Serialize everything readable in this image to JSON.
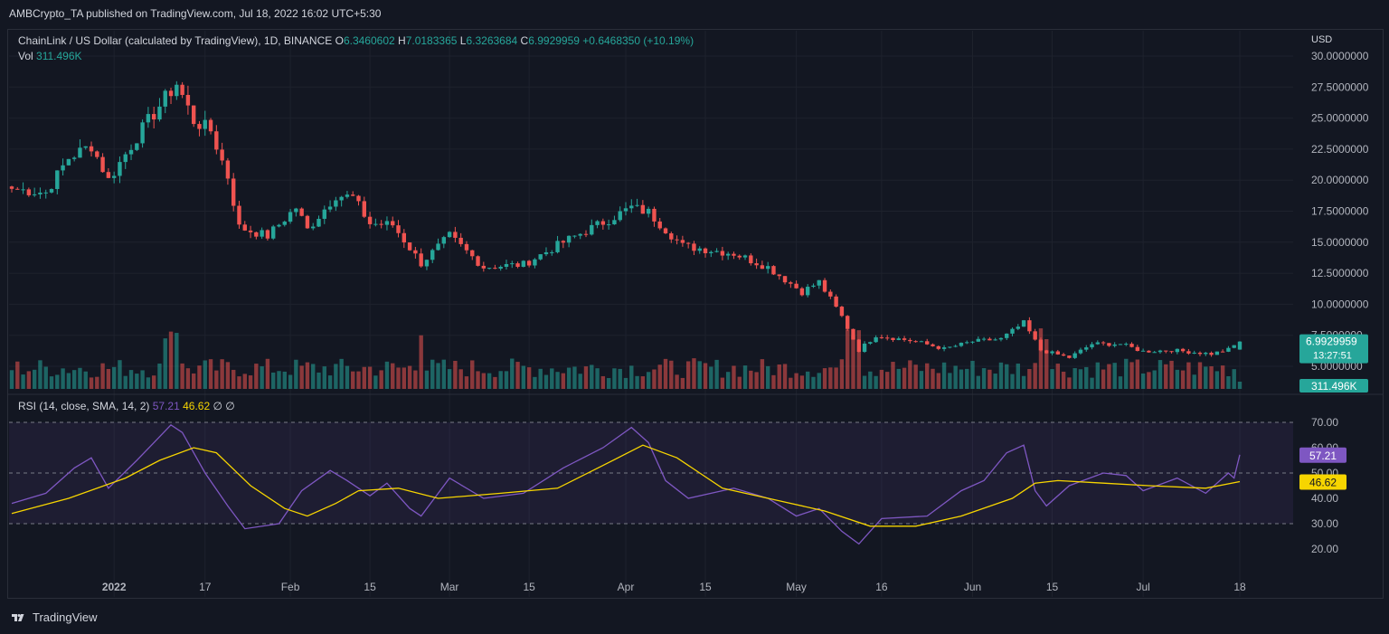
{
  "header": {
    "publisher": "AMBCrypto_TA published on TradingView.com, Jul 18, 2022 16:02 UTC+5:30"
  },
  "legend": {
    "symbol": "ChainLink / US Dollar (calculated by TradingView), 1D, BINANCE",
    "o_label": "O",
    "o_value": "6.3460602",
    "h_label": "H",
    "h_value": "7.0183365",
    "l_label": "L",
    "l_value": "6.3263684",
    "c_label": "C",
    "c_value": "6.9929959",
    "change": "+0.6468350 (+10.19%)",
    "vol_label": "Vol",
    "vol_value": "311.496K"
  },
  "rsi_legend": {
    "label": "RSI (14, close, SMA, 14, 2)",
    "rsi_value": "57.21",
    "sma_value": "46.62",
    "extra": "∅ ∅"
  },
  "price_axis": {
    "currency": "USD",
    "ticks": [
      "30.0000000",
      "27.5000000",
      "25.0000000",
      "22.5000000",
      "20.0000000",
      "17.5000000",
      "15.0000000",
      "12.5000000",
      "10.0000000",
      "7.5000000",
      "5.0000000"
    ],
    "last_price": "6.9929959",
    "countdown": "13:27:51",
    "volume_badge": "311.496K"
  },
  "rsi_axis": {
    "ticks": [
      "70.00",
      "60.00",
      "50.00",
      "40.00",
      "30.00",
      "20.00"
    ],
    "rsi_badge": "57.21",
    "sma_badge": "46.62"
  },
  "time_axis": {
    "labels": [
      "2022",
      "17",
      "Feb",
      "15",
      "Mar",
      "15",
      "Apr",
      "15",
      "May",
      "16",
      "Jun",
      "15",
      "Jul",
      "18"
    ]
  },
  "footer": {
    "brand": "TradingView"
  },
  "colors": {
    "up": "#26a69a",
    "down": "#ef5350",
    "rsi_line": "#7e57c2",
    "sma_line": "#f7d500",
    "background": "#131722",
    "grid": "#1e222d"
  },
  "chart_data": [
    {
      "type": "candlestick",
      "title": "ChainLink / US Dollar (calculated by TradingView), 1D, BINANCE",
      "ylabel": "USD",
      "ylim": [
        5,
        30
      ],
      "x_start": "2021-12-14",
      "x_end": "2022-07-18",
      "close_anchors": [
        {
          "date": "2021-12-14",
          "close": 19.3
        },
        {
          "date": "2021-12-20",
          "close": 19.0
        },
        {
          "date": "2021-12-24",
          "close": 21.8
        },
        {
          "date": "2021-12-28",
          "close": 22.8
        },
        {
          "date": "2021-12-31",
          "close": 20.0
        },
        {
          "date": "2022-01-05",
          "close": 23.5
        },
        {
          "date": "2022-01-09",
          "close": 26.0
        },
        {
          "date": "2022-01-12",
          "close": 27.8
        },
        {
          "date": "2022-01-15",
          "close": 24.8
        },
        {
          "date": "2022-01-18",
          "close": 24.0
        },
        {
          "date": "2022-01-21",
          "close": 20.3
        },
        {
          "date": "2022-01-23",
          "close": 16.2
        },
        {
          "date": "2022-01-28",
          "close": 15.5
        },
        {
          "date": "2022-02-02",
          "close": 17.8
        },
        {
          "date": "2022-02-04",
          "close": 16.0
        },
        {
          "date": "2022-02-09",
          "close": 18.8
        },
        {
          "date": "2022-02-12",
          "close": 18.6
        },
        {
          "date": "2022-02-15",
          "close": 16.5
        },
        {
          "date": "2022-02-19",
          "close": 16.4
        },
        {
          "date": "2022-02-24",
          "close": 13.3
        },
        {
          "date": "2022-03-01",
          "close": 15.5
        },
        {
          "date": "2022-03-07",
          "close": 13.0
        },
        {
          "date": "2022-03-14",
          "close": 13.2
        },
        {
          "date": "2022-03-21",
          "close": 15.0
        },
        {
          "date": "2022-03-28",
          "close": 16.6
        },
        {
          "date": "2022-04-02",
          "close": 17.8
        },
        {
          "date": "2022-04-05",
          "close": 17.4
        },
        {
          "date": "2022-04-11",
          "close": 14.7
        },
        {
          "date": "2022-04-20",
          "close": 14.1
        },
        {
          "date": "2022-04-26",
          "close": 13.0
        },
        {
          "date": "2022-05-02",
          "close": 11.0
        },
        {
          "date": "2022-05-05",
          "close": 11.8
        },
        {
          "date": "2022-05-09",
          "close": 9.0
        },
        {
          "date": "2022-05-12",
          "close": 6.3
        },
        {
          "date": "2022-05-15",
          "close": 7.5
        },
        {
          "date": "2022-05-22",
          "close": 7.0
        },
        {
          "date": "2022-05-27",
          "close": 6.4
        },
        {
          "date": "2022-06-01",
          "close": 7.0
        },
        {
          "date": "2022-06-06",
          "close": 7.2
        },
        {
          "date": "2022-06-10",
          "close": 8.5
        },
        {
          "date": "2022-06-13",
          "close": 6.3
        },
        {
          "date": "2022-06-18",
          "close": 5.7
        },
        {
          "date": "2022-06-22",
          "close": 6.8
        },
        {
          "date": "2022-06-27",
          "close": 6.8
        },
        {
          "date": "2022-07-01",
          "close": 6.2
        },
        {
          "date": "2022-07-06",
          "close": 6.3
        },
        {
          "date": "2022-07-13",
          "close": 6.0
        },
        {
          "date": "2022-07-16",
          "close": 6.35
        },
        {
          "date": "2022-07-18",
          "close": 6.99
        }
      ],
      "last_ohlc": {
        "open": 6.3460602,
        "high": 7.0183365,
        "low": 6.3263684,
        "close": 6.9929959
      }
    },
    {
      "type": "bar",
      "title": "Vol",
      "last_value": "311.496K",
      "spike_dates": [
        "2022-01-10",
        "2022-01-11",
        "2022-01-12",
        "2022-02-24",
        "2022-05-10",
        "2022-05-11",
        "2022-05-12",
        "2022-06-13",
        "2022-06-14"
      ]
    },
    {
      "type": "line",
      "title": "RSI (14, close, SMA, 14, 2)",
      "ylim": [
        15,
        75
      ],
      "bands": [
        30,
        50,
        70
      ],
      "series": [
        {
          "name": "RSI",
          "points": [
            {
              "date": "2021-12-14",
              "value": 38
            },
            {
              "date": "2021-12-20",
              "value": 42
            },
            {
              "date": "2021-12-25",
              "value": 52
            },
            {
              "date": "2021-12-28",
              "value": 56
            },
            {
              "date": "2021-12-31",
              "value": 44
            },
            {
              "date": "2022-01-05",
              "value": 55
            },
            {
              "date": "2022-01-08",
              "value": 62
            },
            {
              "date": "2022-01-11",
              "value": 69
            },
            {
              "date": "2022-01-13",
              "value": 66
            },
            {
              "date": "2022-01-17",
              "value": 50
            },
            {
              "date": "2022-01-21",
              "value": 37
            },
            {
              "date": "2022-01-24",
              "value": 28
            },
            {
              "date": "2022-01-30",
              "value": 30
            },
            {
              "date": "2022-02-03",
              "value": 43
            },
            {
              "date": "2022-02-08",
              "value": 51
            },
            {
              "date": "2022-02-11",
              "value": 47
            },
            {
              "date": "2022-02-15",
              "value": 41
            },
            {
              "date": "2022-02-18",
              "value": 46
            },
            {
              "date": "2022-02-22",
              "value": 36
            },
            {
              "date": "2022-02-24",
              "value": 33
            },
            {
              "date": "2022-03-01",
              "value": 48
            },
            {
              "date": "2022-03-07",
              "value": 40
            },
            {
              "date": "2022-03-14",
              "value": 42
            },
            {
              "date": "2022-03-21",
              "value": 52
            },
            {
              "date": "2022-03-28",
              "value": 60
            },
            {
              "date": "2022-04-02",
              "value": 68
            },
            {
              "date": "2022-04-05",
              "value": 62
            },
            {
              "date": "2022-04-08",
              "value": 47
            },
            {
              "date": "2022-04-12",
              "value": 40
            },
            {
              "date": "2022-04-20",
              "value": 44
            },
            {
              "date": "2022-04-26",
              "value": 40
            },
            {
              "date": "2022-05-01",
              "value": 33
            },
            {
              "date": "2022-05-05",
              "value": 36
            },
            {
              "date": "2022-05-09",
              "value": 27
            },
            {
              "date": "2022-05-12",
              "value": 22
            },
            {
              "date": "2022-05-16",
              "value": 32
            },
            {
              "date": "2022-05-24",
              "value": 33
            },
            {
              "date": "2022-05-30",
              "value": 43
            },
            {
              "date": "2022-06-03",
              "value": 47
            },
            {
              "date": "2022-06-07",
              "value": 58
            },
            {
              "date": "2022-06-10",
              "value": 61
            },
            {
              "date": "2022-06-12",
              "value": 43
            },
            {
              "date": "2022-06-14",
              "value": 37
            },
            {
              "date": "2022-06-18",
              "value": 45
            },
            {
              "date": "2022-06-24",
              "value": 50
            },
            {
              "date": "2022-06-28",
              "value": 49
            },
            {
              "date": "2022-07-01",
              "value": 43
            },
            {
              "date": "2022-07-07",
              "value": 48
            },
            {
              "date": "2022-07-12",
              "value": 42
            },
            {
              "date": "2022-07-16",
              "value": 50
            },
            {
              "date": "2022-07-17",
              "value": 48
            },
            {
              "date": "2022-07-18",
              "value": 57.21
            }
          ]
        },
        {
          "name": "SMA",
          "points": [
            {
              "date": "2021-12-14",
              "value": 34
            },
            {
              "date": "2021-12-24",
              "value": 40
            },
            {
              "date": "2022-01-03",
              "value": 48
            },
            {
              "date": "2022-01-09",
              "value": 55
            },
            {
              "date": "2022-01-15",
              "value": 60
            },
            {
              "date": "2022-01-19",
              "value": 58
            },
            {
              "date": "2022-01-25",
              "value": 45
            },
            {
              "date": "2022-01-31",
              "value": 36
            },
            {
              "date": "2022-02-04",
              "value": 33
            },
            {
              "date": "2022-02-09",
              "value": 38
            },
            {
              "date": "2022-02-13",
              "value": 43
            },
            {
              "date": "2022-02-20",
              "value": 44
            },
            {
              "date": "2022-02-27",
              "value": 40
            },
            {
              "date": "2022-03-10",
              "value": 42
            },
            {
              "date": "2022-03-20",
              "value": 44
            },
            {
              "date": "2022-03-28",
              "value": 53
            },
            {
              "date": "2022-04-04",
              "value": 61
            },
            {
              "date": "2022-04-10",
              "value": 56
            },
            {
              "date": "2022-04-18",
              "value": 44
            },
            {
              "date": "2022-04-28",
              "value": 39
            },
            {
              "date": "2022-05-06",
              "value": 35
            },
            {
              "date": "2022-05-14",
              "value": 29
            },
            {
              "date": "2022-05-22",
              "value": 29
            },
            {
              "date": "2022-05-30",
              "value": 33
            },
            {
              "date": "2022-06-08",
              "value": 40
            },
            {
              "date": "2022-06-12",
              "value": 46
            },
            {
              "date": "2022-06-16",
              "value": 47
            },
            {
              "date": "2022-06-24",
              "value": 46
            },
            {
              "date": "2022-07-02",
              "value": 45
            },
            {
              "date": "2022-07-12",
              "value": 44
            },
            {
              "date": "2022-07-18",
              "value": 46.62
            }
          ]
        }
      ]
    }
  ]
}
